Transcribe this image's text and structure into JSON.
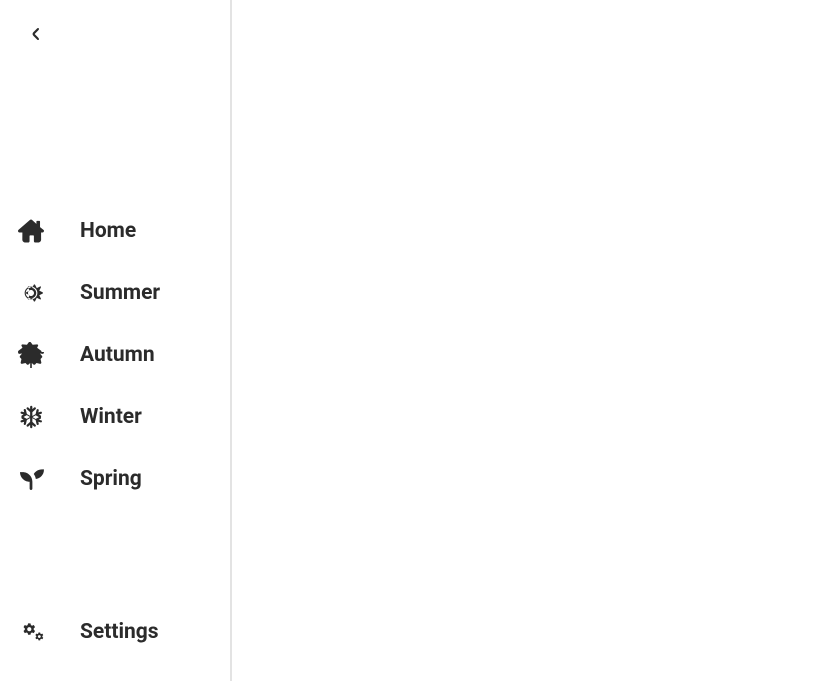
{
  "sidebar": {
    "items": [
      {
        "label": "Home"
      },
      {
        "label": "Summer"
      },
      {
        "label": "Autumn"
      },
      {
        "label": "Winter"
      },
      {
        "label": "Spring"
      }
    ],
    "footer": {
      "settings_label": "Settings"
    }
  }
}
